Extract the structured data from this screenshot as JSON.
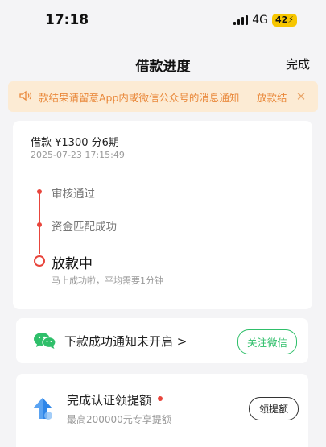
{
  "status_bar": {
    "time": "17:18",
    "network": "4G",
    "battery": "42"
  },
  "nav": {
    "title": "借款进度",
    "done_label": "完成"
  },
  "notice": {
    "text": "款结果请留意App内或微信公众号的消息通知",
    "tail": "放款结",
    "close_icon": "close-icon",
    "speaker_icon": "speaker-icon"
  },
  "loan": {
    "summary": "借款 ¥1300 分6期",
    "datetime": "2025-07-23 17:15:49",
    "steps": [
      {
        "label": "审核通过"
      },
      {
        "label": "资金匹配成功"
      }
    ],
    "current_step": {
      "label": "放款中",
      "sub": "马上成功啦，平均需要1分钟"
    }
  },
  "wechat": {
    "text": "下款成功通知未开启 >",
    "button": "关注微信",
    "icon": "wechat-icon"
  },
  "limit": {
    "title": "完成认证领提额",
    "sub": "最高200000元专享提额",
    "button": "领提额",
    "icon": "up-arrow-icon"
  },
  "colors": {
    "accent_red": "#e8453c",
    "notice_bg": "#fcebd4",
    "notice_text": "#e9883a",
    "wechat_green": "#2fbf6a"
  }
}
